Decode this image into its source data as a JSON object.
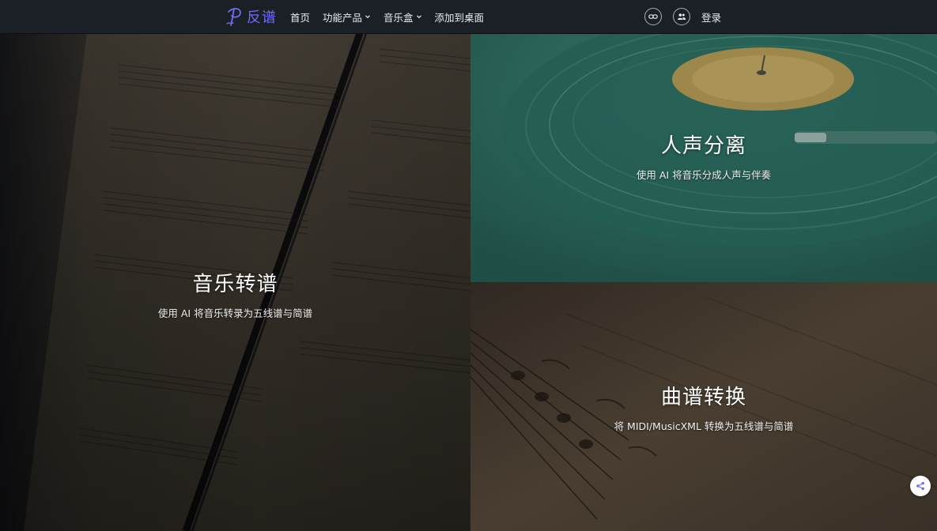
{
  "brand": {
    "logo_text": "反谱",
    "accent_color": "#6f6cf5"
  },
  "nav": {
    "items": [
      {
        "label": "首页",
        "has_dropdown": false
      },
      {
        "label": "功能产品",
        "has_dropdown": true
      },
      {
        "label": "音乐盒",
        "has_dropdown": true
      },
      {
        "label": "添加到桌面",
        "has_dropdown": false
      }
    ],
    "right": {
      "link_icon": "link-icon",
      "users_icon": "users-icon",
      "login_label": "登录"
    }
  },
  "features": {
    "transcribe": {
      "title": "音乐转谱",
      "desc": "使用 AI 将音乐转录为五线谱与简谱"
    },
    "separate": {
      "title": "人声分离",
      "desc": "使用 AI 将音乐分成人声与伴奏"
    },
    "convert": {
      "title": "曲谱转换",
      "desc": "将 MIDI/MusicXML 转换为五线谱与简谱"
    }
  },
  "floating": {
    "share_icon": "share-icon"
  }
}
